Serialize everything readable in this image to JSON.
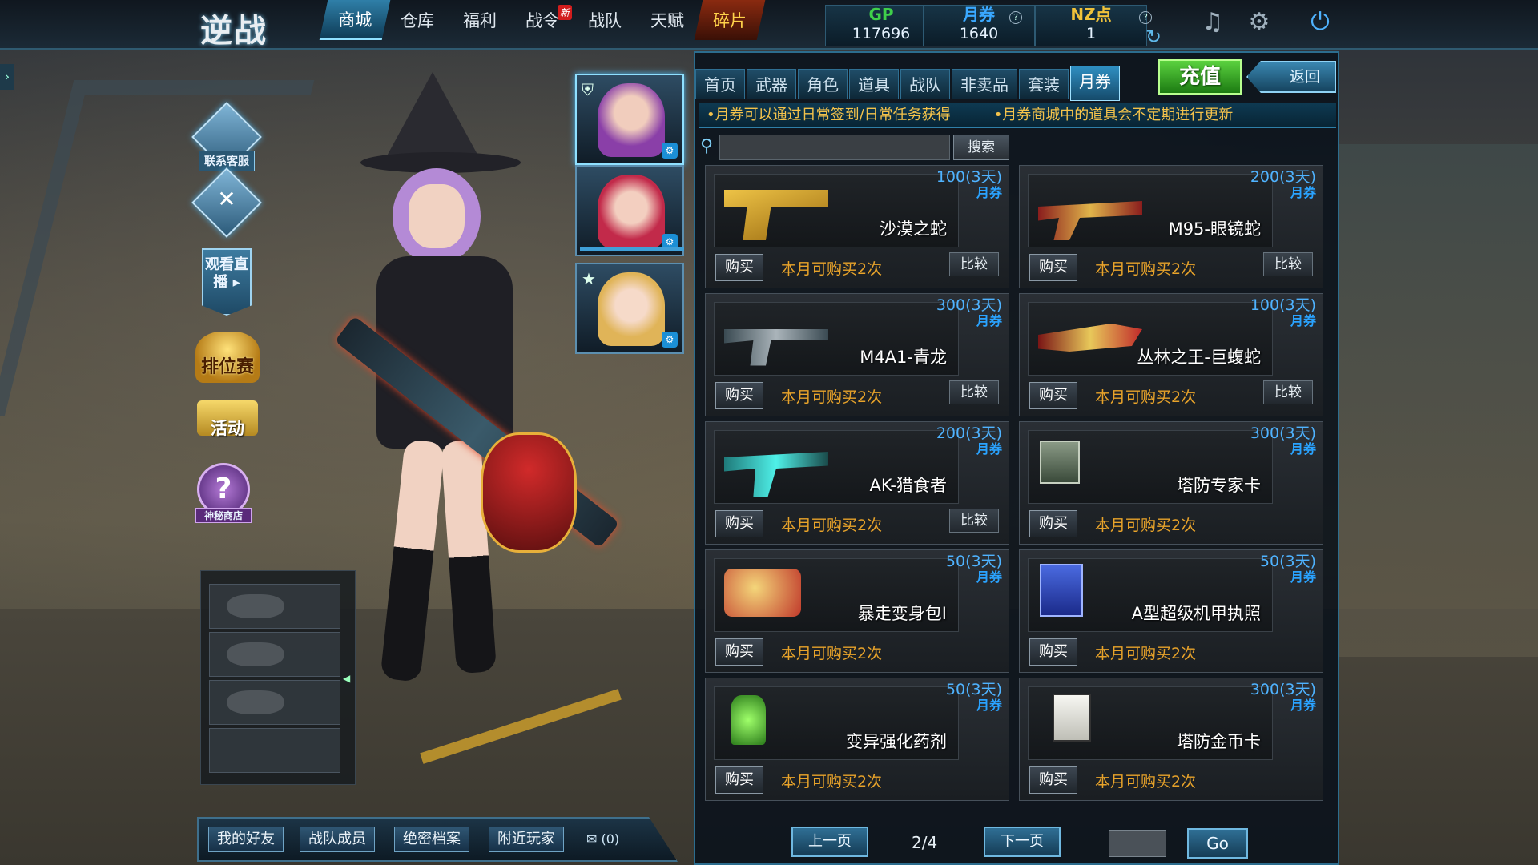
{
  "topbar": {
    "logo": "逆战",
    "nav": [
      {
        "label": "商城",
        "active": true
      },
      {
        "label": "仓库"
      },
      {
        "label": "福利"
      },
      {
        "label": "战令",
        "badge": "新"
      },
      {
        "label": "战队"
      },
      {
        "label": "天赋"
      },
      {
        "label": "碎片",
        "highlight": true
      }
    ],
    "currencies": {
      "gp": {
        "label": "GP",
        "value": "117696",
        "color": "#3fcf4a"
      },
      "voucher": {
        "label": "月券",
        "value": "1640",
        "color": "#3aa8ff"
      },
      "nz": {
        "label": "NZ点",
        "value": "1",
        "color": "#f0c23a"
      }
    },
    "help_glyph": "?",
    "icons": [
      "music-icon",
      "gear-icon",
      "power-icon"
    ]
  },
  "side": {
    "contact_label": "联系客服",
    "live_label": "观看直播",
    "rank_label": "排位赛",
    "event_label": "活动",
    "mystery_label": "神秘商店"
  },
  "social": {
    "buttons": [
      "我的好友",
      "战队成员",
      "绝密档案",
      "附近玩家"
    ],
    "mail_count": "(0)"
  },
  "shop": {
    "tabs": [
      {
        "label": "首页"
      },
      {
        "label": "武器"
      },
      {
        "label": "角色"
      },
      {
        "label": "道具"
      },
      {
        "label": "战队"
      },
      {
        "label": "非卖品"
      },
      {
        "label": "套装"
      },
      {
        "label": "月券",
        "active": true
      }
    ],
    "recharge_label": "充值",
    "back_label": "返回",
    "notices": [
      "•月券可以通过日常签到/日常任务获得",
      "•月券商城中的道具会不定期进行更新"
    ],
    "search": {
      "placeholder": "",
      "button": "搜索"
    },
    "items": [
      {
        "name": "沙漠之蛇",
        "price": "100(3天)",
        "unit": "月券",
        "limit": "本月可购买2次",
        "compare": true,
        "art": "pistol"
      },
      {
        "name": "M95-眼镜蛇",
        "price": "200(3天)",
        "unit": "月券",
        "limit": "本月可购买2次",
        "compare": true,
        "art": "sniper"
      },
      {
        "name": "M4A1-青龙",
        "price": "300(3天)",
        "unit": "月券",
        "limit": "本月可购买2次",
        "compare": true,
        "art": "rifle"
      },
      {
        "name": "丛林之王-巨蝮蛇",
        "price": "100(3天)",
        "unit": "月券",
        "limit": "本月可购买2次",
        "compare": true,
        "art": "blade"
      },
      {
        "name": "AK-猎食者",
        "price": "200(3天)",
        "unit": "月券",
        "limit": "本月可购买2次",
        "compare": true,
        "art": "ak"
      },
      {
        "name": "塔防专家卡",
        "price": "300(3天)",
        "unit": "月券",
        "limit": "本月可购买2次",
        "compare": false,
        "art": "card"
      },
      {
        "name": "暴走变身包I",
        "price": "50(3天)",
        "unit": "月券",
        "limit": "本月可购买2次",
        "compare": false,
        "art": "pack"
      },
      {
        "name": "A型超级机甲执照",
        "price": "50(3天)",
        "unit": "月券",
        "limit": "本月可购买2次",
        "compare": false,
        "art": "license"
      },
      {
        "name": "变异强化药剂",
        "price": "50(3天)",
        "unit": "月券",
        "limit": "本月可购买2次",
        "compare": false,
        "art": "potion"
      },
      {
        "name": "塔防金币卡",
        "price": "300(3天)",
        "unit": "月券",
        "limit": "本月可购买2次",
        "compare": false,
        "art": "coin"
      }
    ],
    "buy_label": "购买",
    "compare_label": "比较",
    "pager": {
      "prev": "上一页",
      "page": "2/4",
      "next": "下一页",
      "go": "Go"
    }
  }
}
